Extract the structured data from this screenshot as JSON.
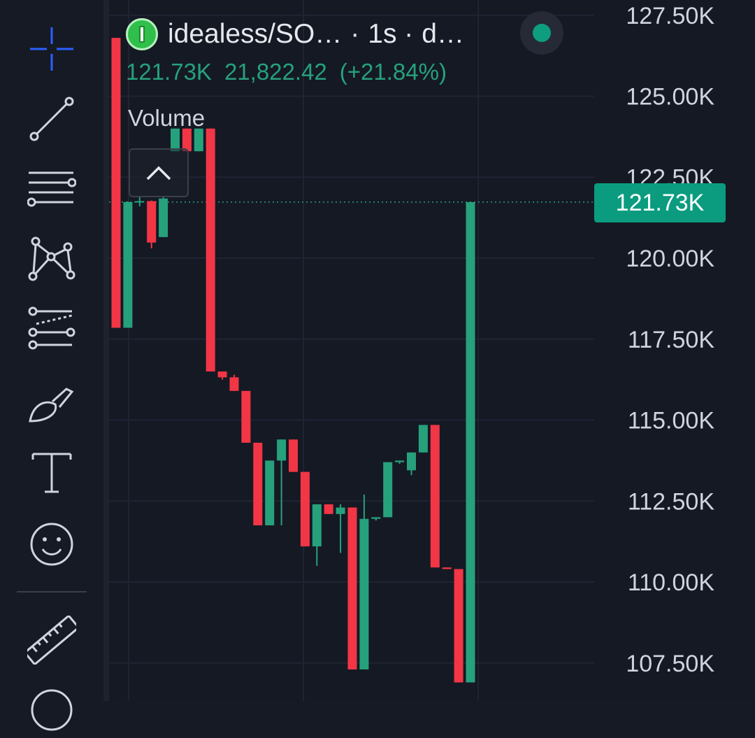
{
  "toolbar": {
    "tools": [
      {
        "name": "crosshair-icon",
        "active": true
      },
      {
        "name": "trend-line-icon"
      },
      {
        "name": "horizontal-lines-icon"
      },
      {
        "name": "pattern-icon"
      },
      {
        "name": "fib-retracement-icon"
      },
      {
        "name": "brush-icon"
      },
      {
        "name": "text-tool-icon",
        "glyph": "T"
      },
      {
        "name": "emoji-icon"
      },
      {
        "name": "ruler-icon"
      }
    ],
    "accent_color": "#2962ff"
  },
  "legend": {
    "symbol": "idealess/SO…",
    "separator": "·",
    "interval": "1s ·",
    "tail": "d…",
    "last_price": "121.73K",
    "change": "21,822.42",
    "change_pct": "(+21.84%)",
    "volume_label": "Volume",
    "collapse_icon": "chevron-up-icon"
  },
  "colors": {
    "up": "#26a17c",
    "down": "#f23645",
    "background": "#151924",
    "grid": "#1f2433",
    "axis_text": "#d1d4dc",
    "last_price_badge": "#0b9c80"
  },
  "chart_data": {
    "type": "candlestick",
    "price_axis": {
      "labels": [
        "127.50K",
        "125.00K",
        "122.50K",
        "120.00K",
        "117.50K",
        "115.00K",
        "112.50K",
        "110.00K",
        "107.50K"
      ],
      "ylim": [
        107000,
        128000
      ]
    },
    "last_price": 121730,
    "last_price_label": "121.73K",
    "candles": [
      {
        "o": 126800,
        "h": 126800,
        "l": 117850,
        "c": 117850
      },
      {
        "o": 117850,
        "h": 121750,
        "l": 117850,
        "c": 121730
      },
      {
        "o": 121730,
        "h": 121900,
        "l": 121600,
        "c": 121760
      },
      {
        "o": 121760,
        "h": 121780,
        "l": 120300,
        "c": 120480
      },
      {
        "o": 120650,
        "h": 121900,
        "l": 120650,
        "c": 121840
      },
      {
        "o": 123300,
        "h": 124000,
        "l": 123300,
        "c": 124000
      },
      {
        "o": 124000,
        "h": 124000,
        "l": 123300,
        "c": 123300
      },
      {
        "o": 123300,
        "h": 124000,
        "l": 123300,
        "c": 124000
      },
      {
        "o": 124000,
        "h": 124000,
        "l": 116500,
        "c": 116500
      },
      {
        "o": 116500,
        "h": 116500,
        "l": 116250,
        "c": 116320
      },
      {
        "o": 116320,
        "h": 116400,
        "l": 115900,
        "c": 115900
      },
      {
        "o": 115900,
        "h": 115900,
        "l": 114300,
        "c": 114300
      },
      {
        "o": 114300,
        "h": 114300,
        "l": 111750,
        "c": 111750
      },
      {
        "o": 111750,
        "h": 113750,
        "l": 111750,
        "c": 113750
      },
      {
        "o": 113750,
        "h": 114400,
        "l": 111750,
        "c": 114400
      },
      {
        "o": 114400,
        "h": 114400,
        "l": 113400,
        "c": 113400
      },
      {
        "o": 113400,
        "h": 113400,
        "l": 111100,
        "c": 111100
      },
      {
        "o": 111100,
        "h": 112400,
        "l": 110500,
        "c": 112400
      },
      {
        "o": 112400,
        "h": 112400,
        "l": 112100,
        "c": 112100
      },
      {
        "o": 112100,
        "h": 112400,
        "l": 110900,
        "c": 112300
      },
      {
        "o": 112300,
        "h": 112300,
        "l": 107300,
        "c": 107300
      },
      {
        "o": 107300,
        "h": 112700,
        "l": 107300,
        "c": 111950
      },
      {
        "o": 111950,
        "h": 112000,
        "l": 111900,
        "c": 112000
      },
      {
        "o": 112000,
        "h": 113700,
        "l": 112000,
        "c": 113700
      },
      {
        "o": 113700,
        "h": 113750,
        "l": 113650,
        "c": 113750
      },
      {
        "o": 113450,
        "h": 114000,
        "l": 113300,
        "c": 114000
      },
      {
        "o": 114000,
        "h": 114850,
        "l": 114000,
        "c": 114850
      },
      {
        "o": 114850,
        "h": 114850,
        "l": 110450,
        "c": 110450
      },
      {
        "o": 110450,
        "h": 110450,
        "l": 110400,
        "c": 110400
      },
      {
        "o": 110400,
        "h": 110400,
        "l": 106900,
        "c": 106900
      },
      {
        "o": 106900,
        "h": 121730,
        "l": 106900,
        "c": 121730
      }
    ]
  }
}
